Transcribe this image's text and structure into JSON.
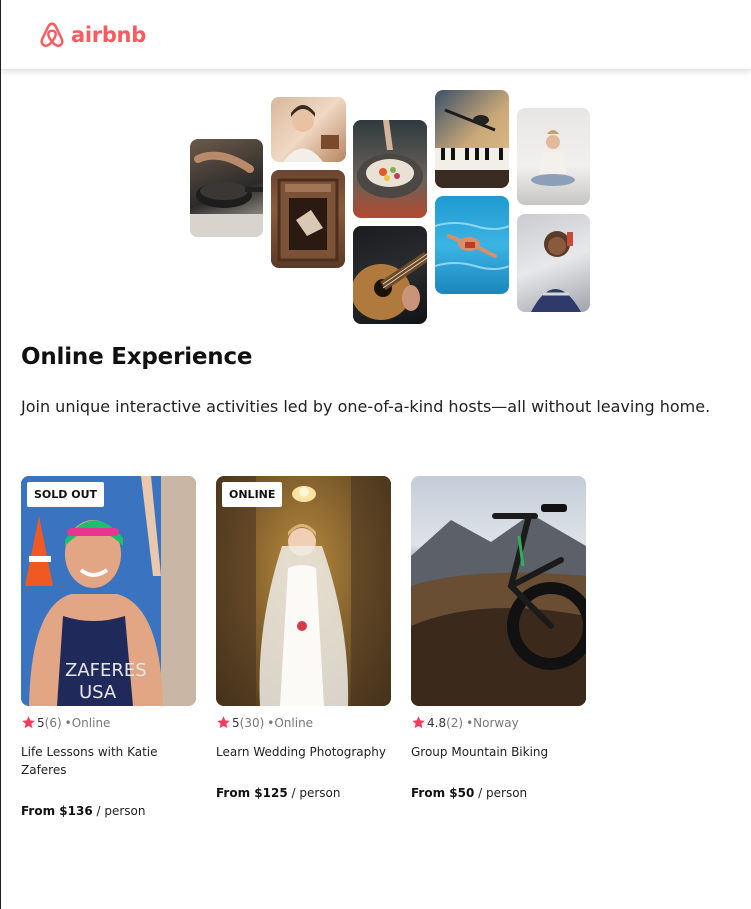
{
  "nav": {
    "logo_text": "airbnb",
    "brand_color": "#ff5a5f"
  },
  "hero": {
    "title": "Online Experience",
    "subtitle": "Join unique interactive activities led by one-of-a-kind hosts—all without leaving home.",
    "collage_images": [
      "cooking",
      "host-portrait",
      "dancer",
      "plated-dish",
      "guitar",
      "microphone-piano",
      "swimmer",
      "yoga",
      "singer"
    ]
  },
  "cards": [
    {
      "badge": "SOLD OUT",
      "image": "athlete-portrait",
      "rating": "5",
      "review_count": "(6)",
      "location": "•Online",
      "title": "Life Lessons with Katie Zaferes",
      "price": "From $136",
      "price_unit": "/ person"
    },
    {
      "badge": "ONLINE",
      "image": "bride-portrait",
      "rating": "5",
      "review_count": "(30)",
      "location": "•Online",
      "title": "Learn Wedding Photography",
      "price": "From $125",
      "price_unit": "/ person"
    },
    {
      "badge": "",
      "image": "mountain-bike",
      "rating": "4.8",
      "review_count": "(2)",
      "location": "•Norway",
      "title": "Group Mountain Biking",
      "price": "From $50",
      "price_unit": "/ person"
    }
  ],
  "colors": {
    "star": "#fe385c",
    "muted_text": "#777777"
  }
}
